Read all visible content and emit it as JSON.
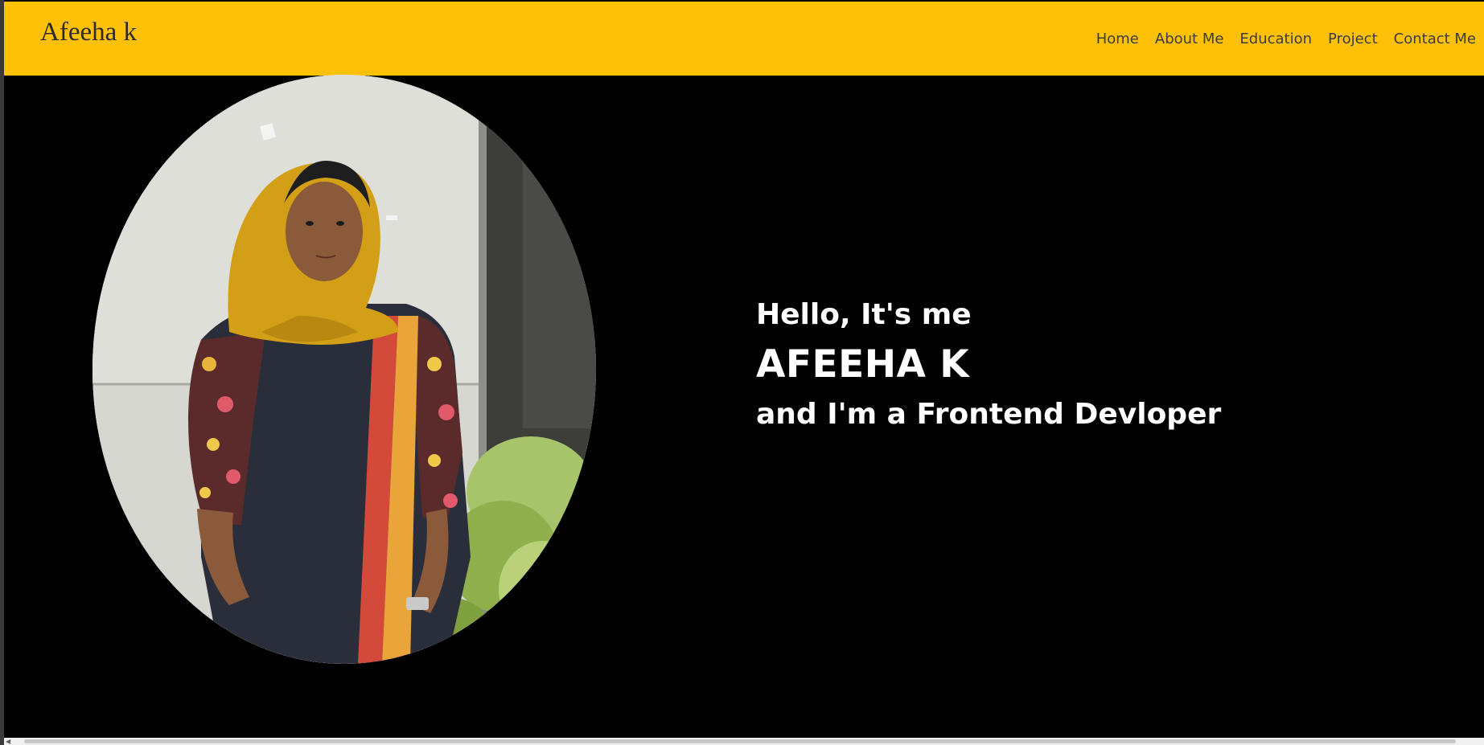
{
  "navbar": {
    "brand": "Afeeha k",
    "background": "#ffc107",
    "links": [
      "Home",
      "About Me",
      "Education",
      "Project",
      "Contact Me"
    ]
  },
  "hero": {
    "greeting": "Hello, It's me",
    "name": "AFEEHA K",
    "role": "and I'm a Frontend Devloper",
    "photo": "profile-photo"
  }
}
